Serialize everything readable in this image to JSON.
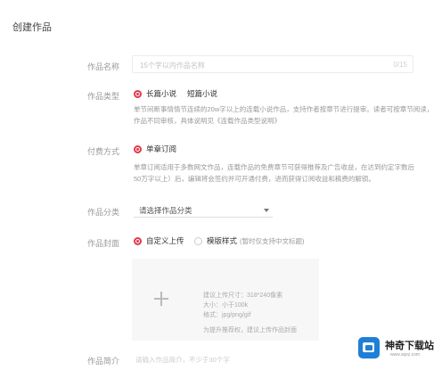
{
  "page": {
    "title": "创建作品"
  },
  "fields": {
    "name": {
      "label": "作品名称",
      "placeholder": "15个字以内作品名称",
      "counter": "0/15"
    },
    "type": {
      "label": "作品类型",
      "options": [
        {
          "label": "长篇小说",
          "selected": true
        },
        {
          "label": "短篇小说",
          "selected": false
        }
      ],
      "desc": "单节间断事情情节连续的20w字以上的连载小说作品，支持作者按章节进行提审。读者可按章节阅读，",
      "desc2": "作品不同审核，具体说明见《连载作品类型说明》"
    },
    "pay": {
      "label": "付费方式",
      "options": [
        {
          "label": "单章订阅",
          "selected": true
        }
      ],
      "desc": "单章订阅适用于多数网文作品，连载作品的免费章节可获得推荐及广告收益，在达到约定字数后",
      "desc2": "50万字以上）后，编辑将会签约并可开通付费，进而获得订阅收益和稿费的解锁。"
    },
    "category": {
      "label": "作品分类",
      "placeholder": "请选择作品分类"
    },
    "cover": {
      "label": "作品封面",
      "options": [
        {
          "label": "自定义上传",
          "selected": true
        },
        {
          "label": "模版样式",
          "selected": false
        }
      ],
      "template_hint": "(暂时仅支持中文标题)",
      "upload_lines": [
        "建议上传尺寸：318*240像素",
        "大小：小于100k",
        "格式：jpg/png/gif",
        "为提升推荐权，建议上传作品封面"
      ]
    },
    "intro": {
      "label": "作品简介",
      "placeholder": "请输入作品简介，不少于30个字"
    }
  },
  "brand": {
    "name": "神奇下载站",
    "url": "www.sqxz.com",
    "color": "#1f7fd6"
  },
  "accent": "#e3384a"
}
